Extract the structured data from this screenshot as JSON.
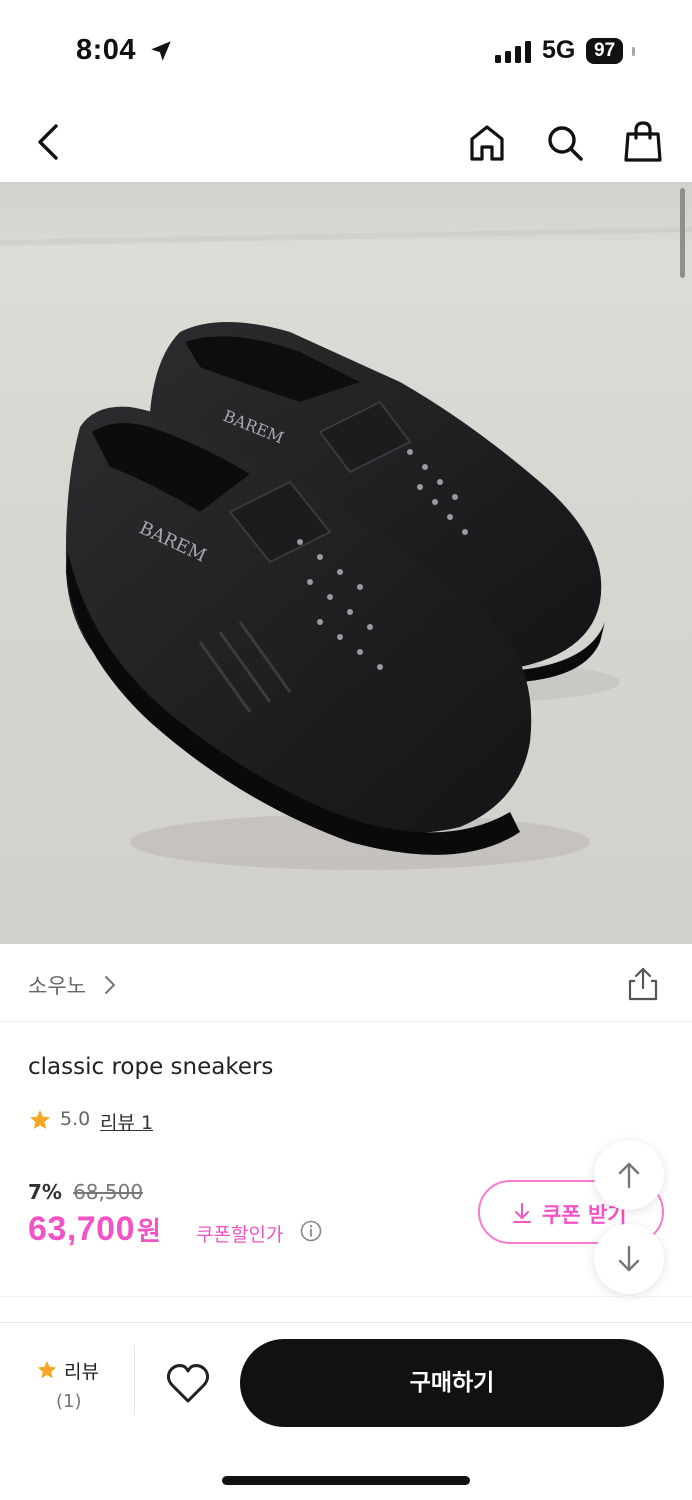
{
  "status_bar": {
    "time": "8:04",
    "network": "5G",
    "battery": "97"
  },
  "nav": {
    "icons": [
      "back-icon",
      "home-icon",
      "search-icon",
      "shopping-bag-icon"
    ]
  },
  "product_image": {
    "description_icon": "black-leather-sneakers-photo",
    "brand_print": "BAREM"
  },
  "brand": {
    "name": "소우노",
    "icon": "chevron-right-icon"
  },
  "product": {
    "title": "classic rope sneakers",
    "rating": "5.0",
    "review_link": "리뷰 1",
    "discount_rate": "7%",
    "original_price": "68,500",
    "sale_price": "63,700",
    "price_unit": "원",
    "coupon_price_label": "쿠폰할인가"
  },
  "coupon": {
    "label": "쿠폰 받기"
  },
  "bottom_bar": {
    "review_label": "리뷰",
    "review_count": "(1)",
    "buy_label": "구매하기"
  },
  "colors": {
    "accent": "#f253c5",
    "star": "#f5a623",
    "buy_button": "#111111"
  }
}
